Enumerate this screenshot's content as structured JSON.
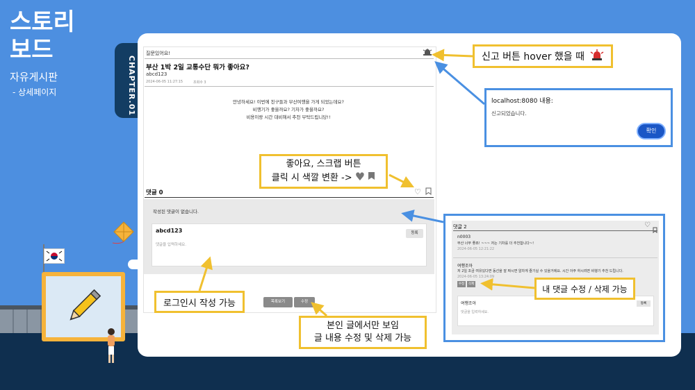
{
  "header": {
    "title_line1": "스토리",
    "title_line2": "보드",
    "subtitle": "자유게시판",
    "subtitle2": "- 상세페이지",
    "chapter": "CHAPTER.01"
  },
  "post": {
    "board_label": "질문있어요!",
    "title": "부산 1박 2일 교통수단 뭐가 좋아요?",
    "author": "abcd123",
    "date": "2024-06-05 11:27:15",
    "views": "조회수 3",
    "body_lines": [
      "안녕하세요! 이번에 친구들과 부산여행을 가게 되었는데요?",
      "비행기가 좋을까요? 기차가 좋을까요?",
      "비용이랑 시간 대비해서 추천 부탁드립니당!!"
    ],
    "comment_count": "댓글 0",
    "no_comment": "작성된 댓글이 없습니다.",
    "write_user": "abcd123",
    "write_placeholder": "댓글을 입력하세요.",
    "register_label": "등록",
    "list_label": "목록보기",
    "edit_label": "수정"
  },
  "annotations": {
    "report_hover": "신고 버튼 hover 했을 때",
    "like_scrap_line1": "좋아요, 스크랩 버튼",
    "like_scrap_line2": "클릭 시 색깔 변환 ->",
    "login_write": "로그인시 작성 가능",
    "owner_line1": "본인 글에서만 보임",
    "owner_line2": "글 내용 수정 및 삭제 가능",
    "my_comment": "내 댓글 수정 / 삭제 가능"
  },
  "alert": {
    "host": "localhost:8080 내용:",
    "message": "신고되었습니다.",
    "ok": "확인"
  },
  "comments_panel": {
    "count": "댓글 2",
    "c1_user": "n0003",
    "c1_text": "부산 너무 좋죠! ~~~ 저는 기차를 더 추천합니다~!",
    "c1_date": "2024-06-05 12:21:22",
    "c2_user": "여행조아",
    "c2_text": "저 2일 조금 여유있다면 동선을 잘 짜시면 알차게 즐기실 수 있을거에요. 시간 아주 하시려면 비행기 추천 드립니다.",
    "c2_date": "2024-06-05 13:24:09",
    "edit": "수정",
    "delete": "삭제",
    "write_user": "여행조아",
    "write_placeholder": "댓글을 입력하세요.",
    "register": "등록"
  },
  "colors": {
    "background": "#4d8fe0",
    "annotation_yellow": "#f0c02f",
    "annotation_blue": "#4a90e2",
    "confirm_button": "#1a56c6"
  },
  "icons": [
    "siren-icon",
    "heart-icon",
    "bookmark-icon",
    "pencil-icon",
    "korean-flag",
    "kite",
    "person"
  ]
}
